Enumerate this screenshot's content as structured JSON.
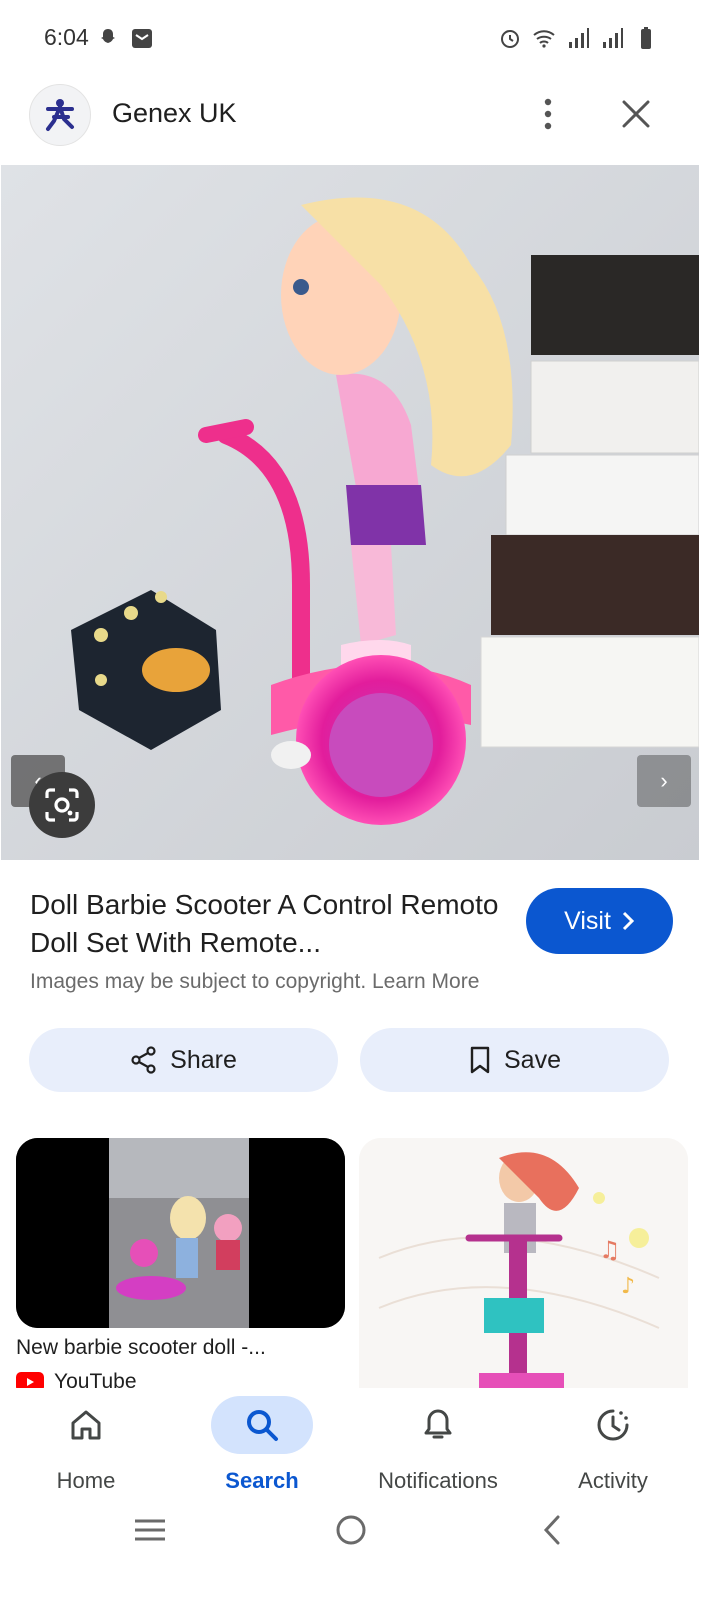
{
  "status_bar": {
    "time": "6:04",
    "left_icons": [
      "snapchat-icon",
      "mail-icon"
    ],
    "right_icons": [
      "alarm-icon",
      "wifi-icon",
      "signal-icon",
      "signal-icon",
      "battery-icon"
    ]
  },
  "header": {
    "site_name": "Genex UK",
    "logo_icon": "genex-logo-icon",
    "more_icon": "more-vert-icon",
    "close_icon": "close-icon"
  },
  "image_viewer": {
    "prev_label": "‹",
    "next_label": "›"
  },
  "result": {
    "title": "Doll Barbie Scooter A Control Remoto Doll Set With Remote...",
    "visit_label": "Visit",
    "copyright_text": "Images may be subject to copyright. Learn More"
  },
  "actions": {
    "share_label": "Share",
    "save_label": "Save"
  },
  "related": [
    {
      "title": "New barbie scooter doll -...",
      "source": "YouTube"
    },
    {
      "title": "",
      "source": ""
    }
  ],
  "bottom_nav": {
    "items": [
      {
        "label": "Home",
        "icon": "home-icon"
      },
      {
        "label": "Search",
        "icon": "search-icon",
        "active": true
      },
      {
        "label": "Notifications",
        "icon": "bell-icon"
      },
      {
        "label": "Activity",
        "icon": "activity-icon"
      }
    ]
  },
  "colors": {
    "accent": "#0b57d0",
    "active_pill": "#d3e3fd",
    "action_button_bg": "#e8eefb"
  }
}
